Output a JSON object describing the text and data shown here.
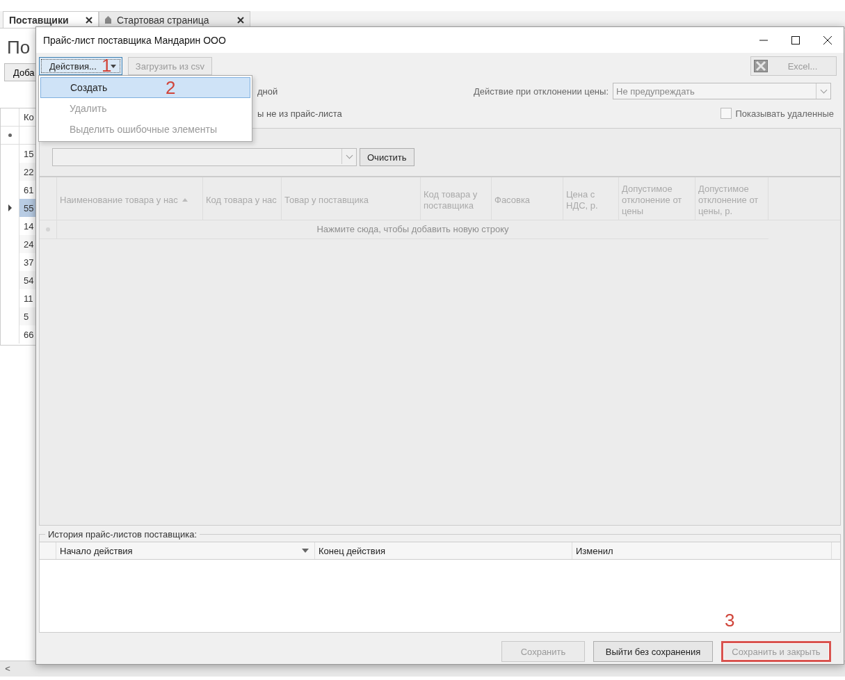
{
  "app": {
    "tabs": [
      {
        "label": "Поставщики",
        "selected": true
      },
      {
        "label": "Стартовая страница",
        "selected": false
      }
    ],
    "title": "По",
    "add_button": "Доба",
    "grid": {
      "column": "Ко",
      "rows": [
        {
          "code": "15",
          "selected": false
        },
        {
          "code": "22",
          "selected": false
        },
        {
          "code": "61",
          "selected": false
        },
        {
          "code": "55",
          "selected": true
        },
        {
          "code": "14",
          "selected": false
        },
        {
          "code": "24",
          "selected": false
        },
        {
          "code": "37",
          "selected": false
        },
        {
          "code": "54",
          "selected": false
        },
        {
          "code": "11",
          "selected": false
        },
        {
          "code": "5",
          "selected": false
        },
        {
          "code": "66",
          "selected": false
        }
      ]
    },
    "scroll_left": "<"
  },
  "dialog": {
    "title": "Прайс-лист поставщика Мандарин ООО",
    "toolbar": {
      "actions_button": {
        "label": "Действия...",
        "annotation": "1"
      },
      "csv_button": {
        "label": "Загрузить из csv",
        "disabled": true
      },
      "excel_button": {
        "label": "Excel...",
        "disabled": true
      }
    },
    "menu": [
      {
        "label": "Создать",
        "selected": true,
        "disabled": false,
        "annotation": "2"
      },
      {
        "label": "Удалить",
        "selected": false,
        "disabled": true
      },
      {
        "label": "Выделить ошибочные элементы",
        "selected": false,
        "disabled": true
      }
    ],
    "partial_option_1": "дной",
    "partial_option_2": "ы не из прайс-листа",
    "price_deviation": {
      "label": "Действие при отклонении цены:",
      "value": "Не предупреждать"
    },
    "show_deleted": {
      "label": "Показывать удаленные",
      "checked": false
    },
    "clear_button": "Очистить",
    "columns": [
      {
        "label": "Наименование товара у нас",
        "sorted": true
      },
      {
        "label": "Код товара у нас",
        "sorted": false
      },
      {
        "label": "Товар у поставщика",
        "sorted": false
      },
      {
        "label": "Код товара у поставщика",
        "sorted": false
      },
      {
        "label": "Фасовка",
        "sorted": false
      },
      {
        "label": "Цена с НДС, р.",
        "sorted": false
      },
      {
        "label": "Допустимое отклонение от цены",
        "sorted": false
      },
      {
        "label": "Допустимое отклонение от цены, р.",
        "sorted": false
      }
    ],
    "new_row_hint": "Нажмите сюда, чтобы добавить новую строку",
    "history": {
      "title": "История прайс-листов поставщика:",
      "columns": [
        {
          "label": "Начало действия",
          "sorted": true
        },
        {
          "label": "Конец действия",
          "sorted": false
        },
        {
          "label": "Изменил",
          "sorted": false
        }
      ]
    },
    "buttons": [
      {
        "label": "Сохранить",
        "disabled": true,
        "highlighted": false
      },
      {
        "label": "Выйти без сохранения",
        "disabled": false,
        "highlighted": false
      },
      {
        "label": "Сохранить и закрыть",
        "disabled": true,
        "highlighted": true,
        "annotation": "3"
      }
    ]
  }
}
